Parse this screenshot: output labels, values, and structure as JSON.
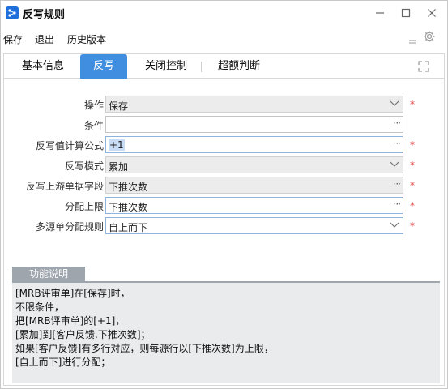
{
  "window": {
    "title": "反写规则",
    "controls": {
      "minimize": "—",
      "maximize": "□",
      "close": "✕"
    }
  },
  "menu": {
    "items": [
      "保存",
      "退出",
      "历史版本"
    ]
  },
  "tabs": [
    "基本信息",
    "反写",
    "关闭控制",
    "超额判断"
  ],
  "active_tab": "反写",
  "form": {
    "operation": {
      "label": "操作",
      "value": "保存"
    },
    "condition": {
      "label": "条件",
      "value": ""
    },
    "formula": {
      "label": "反写值计算公式",
      "value": "+1"
    },
    "mode": {
      "label": "反写模式",
      "value": "累加"
    },
    "upstream_field": {
      "label": "反写上游单据字段",
      "value": "下推次数"
    },
    "limit": {
      "label": "分配上限",
      "value": "下推次数"
    },
    "multi_rule": {
      "label": "多源单分配规则",
      "value": "自上而下"
    },
    "required_mark": "*",
    "ellipsis": "···"
  },
  "description": {
    "tab_label": "功能说明",
    "lines": [
      "[MRB评审单]在[保存]时，",
      "不限条件，",
      "把[MRB评审单]的[+1]，",
      "[累加]到[客户反馈.下推次数]；",
      "如果[客户反馈]有多行对应，则每源行以[下推次数]为上限，",
      "[自上而下]进行分配；"
    ]
  },
  "icons": {
    "app": "app-logo-icon",
    "settings": "gear-icon",
    "expand": "expand-icon",
    "chevron": "chevron-down-icon"
  },
  "colors": {
    "active_tab": "#3f8ee0",
    "required": "#e23b3b",
    "desc_header": "#9ea5ad",
    "desc_bg": "#e9ebed"
  }
}
